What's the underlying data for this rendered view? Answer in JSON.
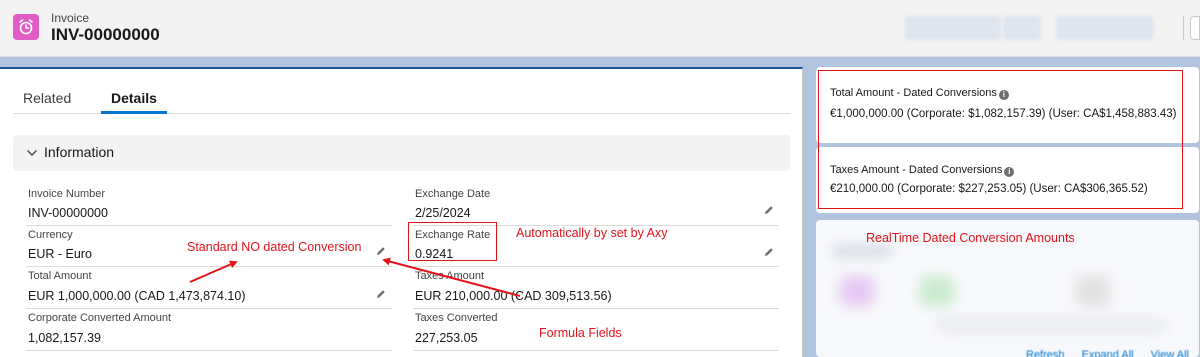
{
  "header": {
    "object_type": "Invoice",
    "record_name": "INV-00000000"
  },
  "tabs": [
    {
      "label": "Related",
      "active": false
    },
    {
      "label": "Details",
      "active": true
    }
  ],
  "section": {
    "title": "Information"
  },
  "fields": {
    "invoice_number": {
      "label": "Invoice Number",
      "value": "INV-00000000"
    },
    "currency": {
      "label": "Currency",
      "value": "EUR - Euro"
    },
    "total_amount": {
      "label": "Total Amount",
      "value": "EUR 1,000,000.00 (CAD 1,473,874.10)"
    },
    "corporate_converted": {
      "label": "Corporate Converted Amount",
      "value": "1,082,157.39"
    },
    "exchange_date": {
      "label": "Exchange Date",
      "value": "2/25/2024"
    },
    "exchange_rate": {
      "label": "Exchange Rate",
      "value": "0.9241"
    },
    "taxes_amount": {
      "label": "Taxes Amount",
      "value": "EUR 210,000.00 (CAD 309,513.56)"
    },
    "taxes_converted": {
      "label": "Taxes Converted",
      "value": "227,253.05"
    }
  },
  "dated_conversions": {
    "total": {
      "title": "Total Amount - Dated Conversions",
      "value": "€1,000,000.00 (Corporate: $1,082,157.39) (User: CA$1,458,883.43)"
    },
    "taxes": {
      "title": "Taxes Amount - Dated Conversions",
      "value": "€210,000.00 (Corporate: $227,253.05) (User: CA$306,365.52)"
    }
  },
  "bottom_links": [
    "Refresh",
    "Expand All",
    "View All"
  ],
  "annotations": {
    "standard": "Standard NO dated Conversion",
    "automatic": "Automatically by set by Axy",
    "realtime": "RealTime Dated Conversion Amounts",
    "formula": "Formula Fields"
  },
  "colors": {
    "brand_blue": "#0176d3",
    "object_icon": "#e15dc6",
    "annotation_red": "#e3131b"
  },
  "icons": [
    "invoice-alarm-icon",
    "chevron-down-icon",
    "pencil-icon",
    "info-icon"
  ]
}
